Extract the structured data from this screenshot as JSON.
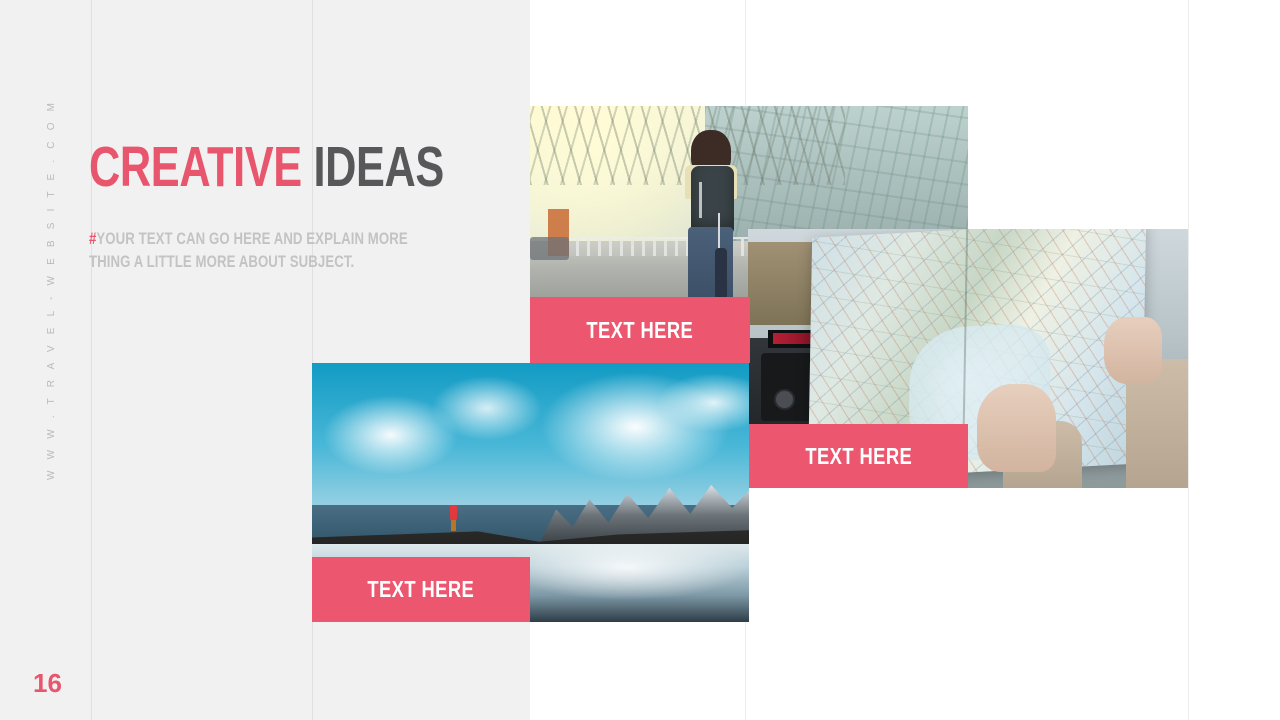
{
  "slide": {
    "page_number": "16",
    "vertical_url": "W W W . T R A V E L - W E B S I T E . C O M",
    "background_color": "#f1f1f1",
    "panel_color": "#ffffff",
    "accent_color": "#ec566e",
    "dark_text_color": "#58585a"
  },
  "headline": {
    "accent_word": "CREATIVE",
    "plain_word": " IDEAS"
  },
  "subtitle": {
    "hash": "#",
    "text": "YOUR TEXT CAN GO HERE AND EXPLAIN MORE THING A LITTLE MORE ABOUT SUBJECT."
  },
  "photos": [
    {
      "name": "airport-terminal",
      "alt": "Woman with backpack pulling luggage in a sunlit airport terminal",
      "label": "TEXT HERE"
    },
    {
      "name": "road-map-in-car",
      "alt": "Hands holding an open road map inside a car near the coast",
      "label": "TEXT HERE"
    },
    {
      "name": "fjord-landscape",
      "alt": "Person in red jacket on a rocky shore facing snowy mountains reflected in water",
      "label": "TEXT HERE"
    }
  ]
}
